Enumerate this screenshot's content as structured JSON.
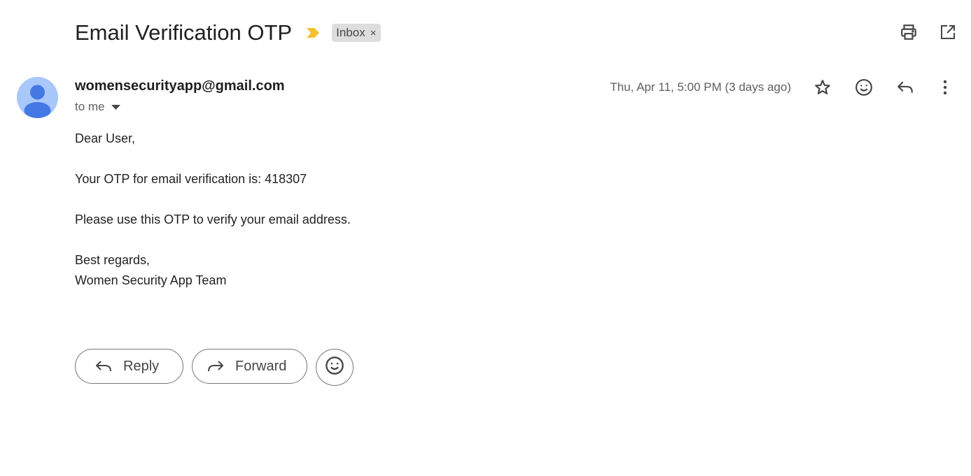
{
  "subject": {
    "title": "Email Verification OTP",
    "importance_icon": "importance-marker-icon",
    "label": "Inbox",
    "label_remove": "×"
  },
  "toolbar": {
    "print_icon": "print-icon",
    "popout_icon": "open-in-new-window-icon"
  },
  "message": {
    "sender": "womensecurityapp@gmail.com",
    "recipient_line": "to me",
    "date": "Thu, Apr 11, 5:00 PM (3 days ago)",
    "icons": [
      "star-icon",
      "emoji-react-icon",
      "reply-icon",
      "more-vert-icon"
    ]
  },
  "body": {
    "greeting": "Dear User,",
    "otp_line": "Your OTP for email verification is: 418307",
    "instruction": "Please use this OTP to verify your email address.",
    "closing": "Best regards,",
    "signature": "Women Security App Team"
  },
  "actions": {
    "reply_label": "Reply",
    "forward_label": "Forward"
  },
  "colors": {
    "importance": "#f2c230",
    "avatar_bg": "#a8c7fa",
    "avatar_fg": "#4478e4",
    "chip_bg": "#dddddd"
  }
}
